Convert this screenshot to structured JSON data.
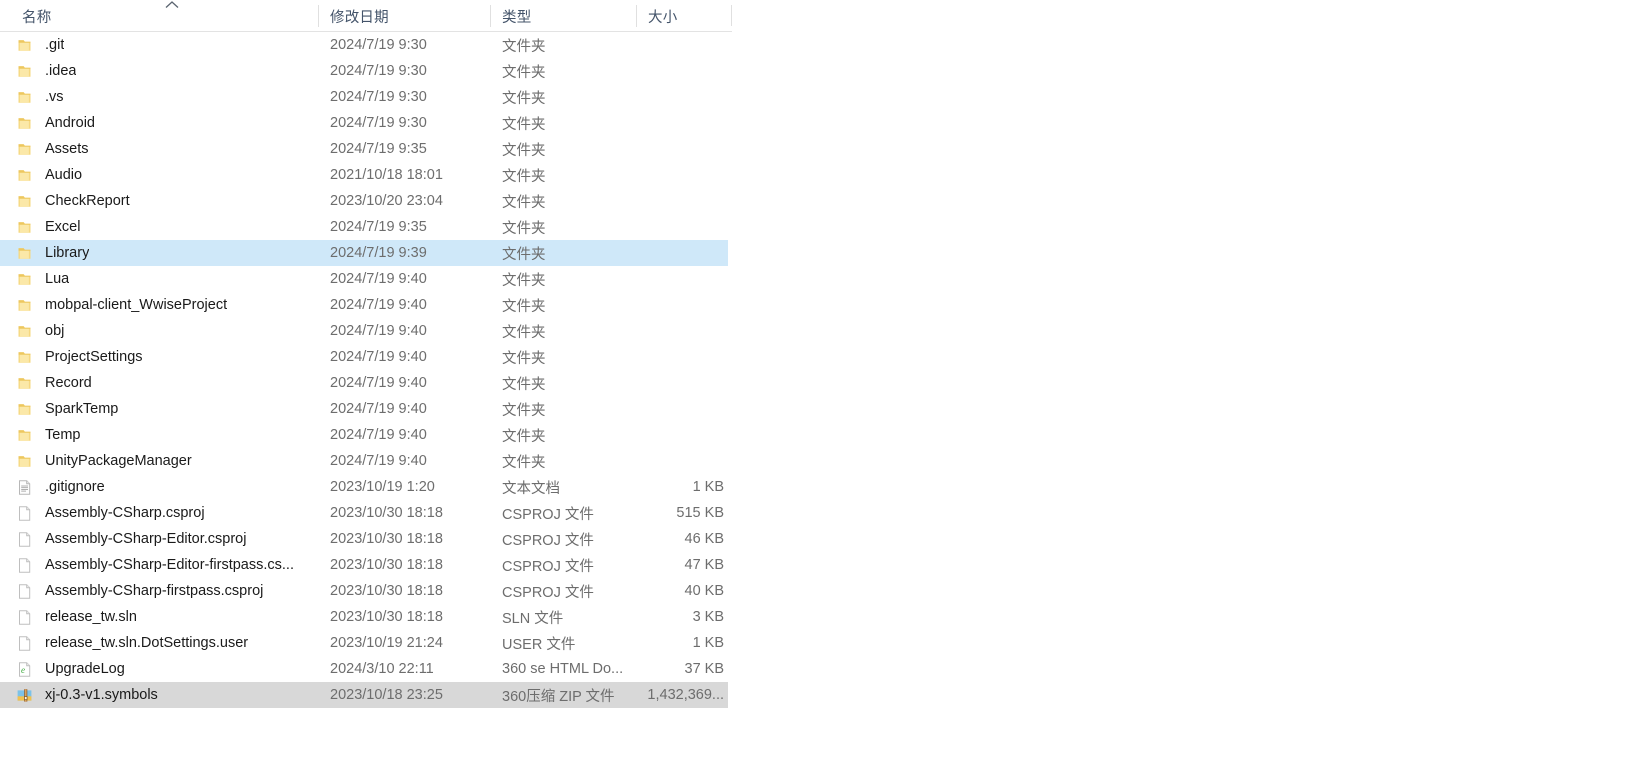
{
  "window": {
    "view_mode": "details",
    "accent_selected": "#cfe8f9",
    "accent_selected_idle": "#d8d8d8",
    "header_text_color": "#44546a"
  },
  "columns": {
    "name": {
      "label": "名称",
      "sort": "ascending",
      "sort_icon": "chevron-up-icon"
    },
    "date": {
      "label": "修改日期"
    },
    "type": {
      "label": "类型"
    },
    "size": {
      "label": "大小"
    }
  },
  "rows": [
    {
      "icon": "folder-icon",
      "name": ".git",
      "date": "2024/7/19 9:30",
      "type": "文件夹",
      "size": "",
      "state": "normal"
    },
    {
      "icon": "folder-icon",
      "name": ".idea",
      "date": "2024/7/19 9:30",
      "type": "文件夹",
      "size": "",
      "state": "normal"
    },
    {
      "icon": "folder-icon",
      "name": ".vs",
      "date": "2024/7/19 9:30",
      "type": "文件夹",
      "size": "",
      "state": "normal"
    },
    {
      "icon": "folder-icon",
      "name": "Android",
      "date": "2024/7/19 9:30",
      "type": "文件夹",
      "size": "",
      "state": "normal"
    },
    {
      "icon": "folder-icon",
      "name": "Assets",
      "date": "2024/7/19 9:35",
      "type": "文件夹",
      "size": "",
      "state": "normal"
    },
    {
      "icon": "folder-icon",
      "name": "Audio",
      "date": "2021/10/18 18:01",
      "type": "文件夹",
      "size": "",
      "state": "normal"
    },
    {
      "icon": "folder-icon",
      "name": "CheckReport",
      "date": "2023/10/20 23:04",
      "type": "文件夹",
      "size": "",
      "state": "normal"
    },
    {
      "icon": "folder-icon",
      "name": "Excel",
      "date": "2024/7/19 9:35",
      "type": "文件夹",
      "size": "",
      "state": "normal"
    },
    {
      "icon": "folder-icon",
      "name": "Library",
      "date": "2024/7/19 9:39",
      "type": "文件夹",
      "size": "",
      "state": "selected"
    },
    {
      "icon": "folder-icon",
      "name": "Lua",
      "date": "2024/7/19 9:40",
      "type": "文件夹",
      "size": "",
      "state": "normal"
    },
    {
      "icon": "folder-icon",
      "name": "mobpal-client_WwiseProject",
      "date": "2024/7/19 9:40",
      "type": "文件夹",
      "size": "",
      "state": "normal"
    },
    {
      "icon": "folder-icon",
      "name": "obj",
      "date": "2024/7/19 9:40",
      "type": "文件夹",
      "size": "",
      "state": "normal"
    },
    {
      "icon": "folder-icon",
      "name": "ProjectSettings",
      "date": "2024/7/19 9:40",
      "type": "文件夹",
      "size": "",
      "state": "normal"
    },
    {
      "icon": "folder-icon",
      "name": "Record",
      "date": "2024/7/19 9:40",
      "type": "文件夹",
      "size": "",
      "state": "normal"
    },
    {
      "icon": "folder-icon",
      "name": "SparkTemp",
      "date": "2024/7/19 9:40",
      "type": "文件夹",
      "size": "",
      "state": "normal"
    },
    {
      "icon": "folder-icon",
      "name": "Temp",
      "date": "2024/7/19 9:40",
      "type": "文件夹",
      "size": "",
      "state": "normal"
    },
    {
      "icon": "folder-icon",
      "name": "UnityPackageManager",
      "date": "2024/7/19 9:40",
      "type": "文件夹",
      "size": "",
      "state": "normal"
    },
    {
      "icon": "text-file-icon",
      "name": ".gitignore",
      "date": "2023/10/19 1:20",
      "type": "文本文档",
      "size": "1 KB",
      "state": "normal"
    },
    {
      "icon": "blank-file-icon",
      "name": "Assembly-CSharp.csproj",
      "date": "2023/10/30 18:18",
      "type": "CSPROJ 文件",
      "size": "515 KB",
      "state": "normal"
    },
    {
      "icon": "blank-file-icon",
      "name": "Assembly-CSharp-Editor.csproj",
      "date": "2023/10/30 18:18",
      "type": "CSPROJ 文件",
      "size": "46 KB",
      "state": "normal"
    },
    {
      "icon": "blank-file-icon",
      "name": "Assembly-CSharp-Editor-firstpass.cs...",
      "date": "2023/10/30 18:18",
      "type": "CSPROJ 文件",
      "size": "47 KB",
      "state": "normal"
    },
    {
      "icon": "blank-file-icon",
      "name": "Assembly-CSharp-firstpass.csproj",
      "date": "2023/10/30 18:18",
      "type": "CSPROJ 文件",
      "size": "40 KB",
      "state": "normal"
    },
    {
      "icon": "blank-file-icon",
      "name": "release_tw.sln",
      "date": "2023/10/30 18:18",
      "type": "SLN 文件",
      "size": "3 KB",
      "state": "normal"
    },
    {
      "icon": "blank-file-icon",
      "name": "release_tw.sln.DotSettings.user",
      "date": "2023/10/19 21:24",
      "type": "USER 文件",
      "size": "1 KB",
      "state": "normal"
    },
    {
      "icon": "html-doc-icon",
      "name": "UpgradeLog",
      "date": "2024/3/10 22:11",
      "type": "360 se HTML Do...",
      "size": "37 KB",
      "state": "normal"
    },
    {
      "icon": "zip-archive-icon",
      "name": "xj-0.3-v1.symbols",
      "date": "2023/10/18 23:25",
      "type": "360压缩 ZIP 文件",
      "size": "1,432,369...",
      "state": "selected-idle"
    }
  ]
}
